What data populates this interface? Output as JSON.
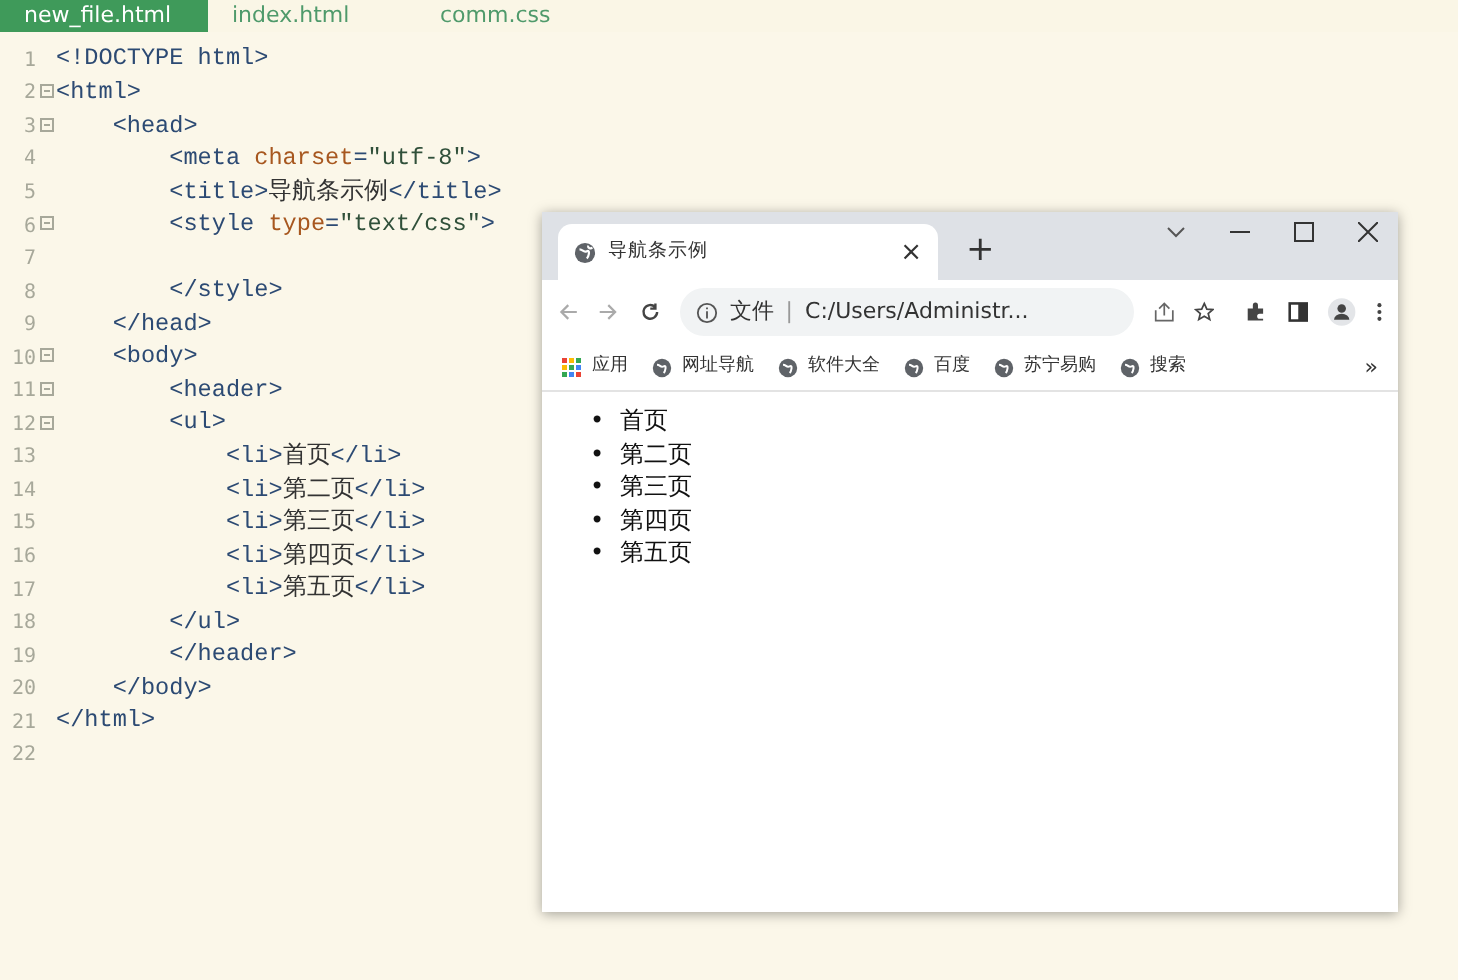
{
  "editor": {
    "tabs": [
      {
        "label": "new_file.html",
        "selected": true
      },
      {
        "label": "index.html",
        "selected": false
      },
      {
        "label": "comm.css",
        "selected": false
      }
    ],
    "lines": [
      {
        "number": "1",
        "fold": false,
        "tokens": [
          {
            "text": "<!DOCTYPE html>",
            "kind": "tag"
          }
        ]
      },
      {
        "number": "2",
        "fold": true,
        "tokens": [
          {
            "text": "<html>",
            "kind": "tag"
          }
        ]
      },
      {
        "number": "3",
        "fold": true,
        "tokens": [
          {
            "text": "    <head>",
            "kind": "tag"
          }
        ]
      },
      {
        "number": "4",
        "fold": false,
        "tokens": [
          {
            "text": "        <meta ",
            "kind": "tag"
          },
          {
            "text": "charset",
            "kind": "attr"
          },
          {
            "text": "=",
            "kind": "tag"
          },
          {
            "text": "\"utf-8\"",
            "kind": "value"
          },
          {
            "text": ">",
            "kind": "tag"
          }
        ]
      },
      {
        "number": "5",
        "fold": false,
        "tokens": [
          {
            "text": "        <title>",
            "kind": "tag"
          },
          {
            "text": "导航条示例",
            "kind": "text"
          },
          {
            "text": "</title>",
            "kind": "tag"
          }
        ]
      },
      {
        "number": "6",
        "fold": true,
        "tokens": [
          {
            "text": "        <style ",
            "kind": "tag"
          },
          {
            "text": "type",
            "kind": "attr"
          },
          {
            "text": "=",
            "kind": "tag"
          },
          {
            "text": "\"text/css\"",
            "kind": "value"
          },
          {
            "text": ">",
            "kind": "tag"
          }
        ]
      },
      {
        "number": "7",
        "fold": false
      },
      {
        "number": "8",
        "fold": false,
        "tokens": [
          {
            "text": "        </style>",
            "kind": "tag"
          }
        ]
      },
      {
        "number": "9",
        "fold": false,
        "tokens": [
          {
            "text": "    </head>",
            "kind": "tag"
          }
        ]
      },
      {
        "number": "10",
        "fold": true,
        "tokens": [
          {
            "text": "    <body>",
            "kind": "tag"
          }
        ]
      },
      {
        "number": "11",
        "fold": true,
        "tokens": [
          {
            "text": "        <header>",
            "kind": "tag"
          }
        ]
      },
      {
        "number": "12",
        "fold": true,
        "tokens": [
          {
            "text": "        <ul>",
            "kind": "tag"
          }
        ]
      },
      {
        "number": "13",
        "fold": false,
        "tokens": [
          {
            "text": "            <li>",
            "kind": "tag"
          },
          {
            "text": "首页",
            "kind": "text"
          },
          {
            "text": "</li>",
            "kind": "tag"
          }
        ]
      },
      {
        "number": "14",
        "fold": false,
        "tokens": [
          {
            "text": "            <li>",
            "kind": "tag"
          },
          {
            "text": "第二页",
            "kind": "text"
          },
          {
            "text": "</li>",
            "kind": "tag"
          }
        ]
      },
      {
        "number": "15",
        "fold": false,
        "tokens": [
          {
            "text": "            <li>",
            "kind": "tag"
          },
          {
            "text": "第三页",
            "kind": "text"
          },
          {
            "text": "</li>",
            "kind": "tag"
          }
        ]
      },
      {
        "number": "16",
        "fold": false,
        "tokens": [
          {
            "text": "            <li>",
            "kind": "tag"
          },
          {
            "text": "第四页",
            "kind": "text"
          },
          {
            "text": "</li>",
            "kind": "tag"
          }
        ]
      },
      {
        "number": "17",
        "fold": false,
        "tokens": [
          {
            "text": "            <li>",
            "kind": "tag"
          },
          {
            "text": "第五页",
            "kind": "text"
          },
          {
            "text": "</li>",
            "kind": "tag"
          }
        ]
      },
      {
        "number": "18",
        "fold": false,
        "tokens": [
          {
            "text": "        </ul>",
            "kind": "tag"
          }
        ]
      },
      {
        "number": "19",
        "fold": false,
        "tokens": [
          {
            "text": "        </header>",
            "kind": "tag"
          }
        ]
      },
      {
        "number": "20",
        "fold": false,
        "tokens": [
          {
            "text": "    </body>",
            "kind": "tag"
          }
        ]
      },
      {
        "number": "21",
        "fold": false,
        "tokens": [
          {
            "text": "</html>",
            "kind": "tag"
          }
        ]
      },
      {
        "number": "22",
        "fold": false
      }
    ]
  },
  "browser": {
    "tab": {
      "title": "导航条示例",
      "close": "×"
    },
    "new_tab": "+",
    "address": {
      "scheme": "文件",
      "separator": "|",
      "url": "C:/Users/Administr..."
    },
    "bookmarks": [
      {
        "label": "应用",
        "kind": "apps"
      },
      {
        "label": "网址导航",
        "kind": "site"
      },
      {
        "label": "软件大全",
        "kind": "site"
      },
      {
        "label": "百度",
        "kind": "site"
      },
      {
        "label": "苏宁易购",
        "kind": "site"
      },
      {
        "label": "搜索",
        "kind": "site"
      }
    ],
    "more": "»",
    "page_items": [
      {
        "bullet": "•",
        "label": "首页"
      },
      {
        "bullet": "•",
        "label": "第二页"
      },
      {
        "bullet": "•",
        "label": "第三页"
      },
      {
        "bullet": "•",
        "label": "第四页"
      },
      {
        "bullet": "•",
        "label": "第五页"
      }
    ]
  }
}
